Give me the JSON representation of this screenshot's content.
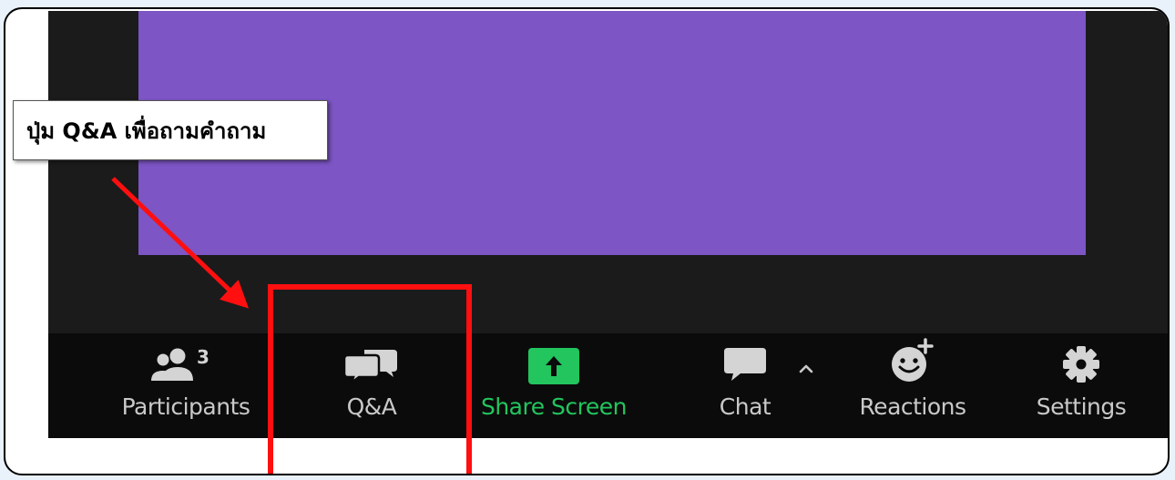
{
  "callout": {
    "text": "ปุ่ม Q&A เพื่อถามคำถาม"
  },
  "toolbar": {
    "participants": {
      "label": "Participants",
      "count": "3",
      "icon": "participants-icon"
    },
    "qa": {
      "label": "Q&A",
      "icon": "qa-icon"
    },
    "share_screen": {
      "label": "Share Screen",
      "icon": "share-screen-icon"
    },
    "chat": {
      "label": "Chat",
      "caret": "^",
      "icon": "chat-icon"
    },
    "reactions": {
      "label": "Reactions",
      "icon": "reactions-icon"
    },
    "settings": {
      "label": "Settings",
      "icon": "gear-icon"
    }
  },
  "colors": {
    "video": "#7d55c5",
    "stage": "#1b1b1b",
    "toolbar": "#0b0b0b",
    "share_green": "#22c55e",
    "annotation_red": "#ff0f0f"
  }
}
